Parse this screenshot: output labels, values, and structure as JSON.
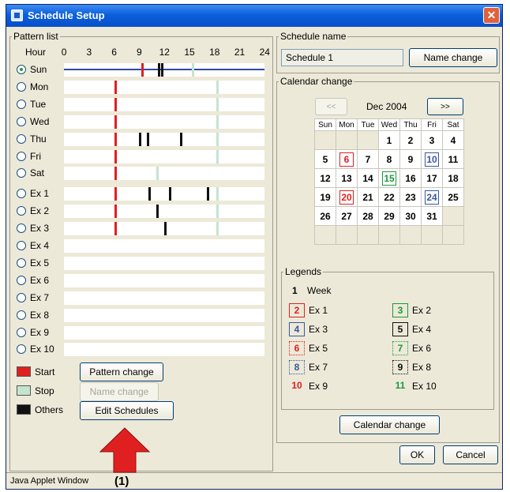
{
  "window": {
    "title": "Schedule Setup",
    "status": "Java Applet Window"
  },
  "pattern_list": {
    "legend": "Pattern list",
    "hour_label": "Hour",
    "hour_ticks": [
      "0",
      "3",
      "6",
      "9",
      "12",
      "15",
      "18",
      "21",
      "24"
    ],
    "rows": [
      {
        "label": "Sun",
        "checked": true,
        "marks": [
          {
            "h": 9.3,
            "t": "start"
          },
          {
            "h": 15.3,
            "t": "stop"
          },
          {
            "h": 11.2,
            "t": "other"
          },
          {
            "h": 11.6,
            "t": "other"
          }
        ]
      },
      {
        "label": "Mon",
        "checked": false,
        "marks": [
          {
            "h": 6,
            "t": "start"
          },
          {
            "h": 18.2,
            "t": "stop"
          }
        ]
      },
      {
        "label": "Tue",
        "checked": false,
        "marks": [
          {
            "h": 6,
            "t": "start"
          },
          {
            "h": 18.2,
            "t": "stop"
          }
        ]
      },
      {
        "label": "Wed",
        "checked": false,
        "marks": [
          {
            "h": 6,
            "t": "start"
          },
          {
            "h": 18.2,
            "t": "stop"
          }
        ]
      },
      {
        "label": "Thu",
        "checked": false,
        "marks": [
          {
            "h": 6,
            "t": "start"
          },
          {
            "h": 18.2,
            "t": "stop"
          },
          {
            "h": 9,
            "t": "other"
          },
          {
            "h": 9.9,
            "t": "other"
          },
          {
            "h": 13.9,
            "t": "other"
          }
        ]
      },
      {
        "label": "Fri",
        "checked": false,
        "marks": [
          {
            "h": 6,
            "t": "start"
          },
          {
            "h": 18.2,
            "t": "stop"
          }
        ]
      },
      {
        "label": "Sat",
        "checked": false,
        "marks": [
          {
            "h": 6,
            "t": "start"
          },
          {
            "h": 11.1,
            "t": "stop"
          }
        ]
      },
      {
        "label": "Ex 1",
        "checked": false,
        "marks": [
          {
            "h": 6,
            "t": "start"
          },
          {
            "h": 18.2,
            "t": "stop"
          },
          {
            "h": 10.1,
            "t": "other"
          },
          {
            "h": 12.6,
            "t": "other"
          },
          {
            "h": 17.1,
            "t": "other"
          }
        ]
      },
      {
        "label": "Ex 2",
        "checked": false,
        "marks": [
          {
            "h": 6,
            "t": "start"
          },
          {
            "h": 18.2,
            "t": "stop"
          },
          {
            "h": 11.1,
            "t": "other"
          }
        ]
      },
      {
        "label": "Ex 3",
        "checked": false,
        "marks": [
          {
            "h": 6,
            "t": "start"
          },
          {
            "h": 18.2,
            "t": "stop"
          },
          {
            "h": 12.0,
            "t": "other"
          }
        ]
      },
      {
        "label": "Ex 4",
        "checked": false,
        "marks": []
      },
      {
        "label": "Ex 5",
        "checked": false,
        "marks": []
      },
      {
        "label": "Ex 6",
        "checked": false,
        "marks": []
      },
      {
        "label": "Ex 7",
        "checked": false,
        "marks": []
      },
      {
        "label": "Ex 8",
        "checked": false,
        "marks": []
      },
      {
        "label": "Ex 9",
        "checked": false,
        "marks": []
      },
      {
        "label": "Ex 10",
        "checked": false,
        "marks": []
      }
    ],
    "legend_items": [
      "Start",
      "Stop",
      "Others"
    ],
    "buttons": {
      "pattern_change": "Pattern change",
      "name_change": "Name change",
      "edit_schedules": "Edit Schedules"
    }
  },
  "schedule_name": {
    "legend": "Schedule name",
    "value": "Schedule 1",
    "button": "Name change"
  },
  "calendar": {
    "legend": "Calendar change",
    "prev": "<<",
    "next": ">>",
    "month": "Dec 2004",
    "weekdays": [
      "Sun",
      "Mon",
      "Tue",
      "Wed",
      "Thu",
      "Fri",
      "Sat"
    ],
    "weeks": [
      [
        {
          "d": ""
        },
        {
          "d": ""
        },
        {
          "d": ""
        },
        {
          "d": "1",
          "c": "week"
        },
        {
          "d": "2",
          "c": "week"
        },
        {
          "d": "3",
          "c": "week"
        },
        {
          "d": "4",
          "c": "week"
        }
      ],
      [
        {
          "d": "5",
          "c": "week"
        },
        {
          "d": "6",
          "c": "ex1"
        },
        {
          "d": "7",
          "c": "week"
        },
        {
          "d": "8",
          "c": "week"
        },
        {
          "d": "9",
          "c": "week"
        },
        {
          "d": "10",
          "c": "ex3"
        },
        {
          "d": "11",
          "c": "week"
        }
      ],
      [
        {
          "d": "12",
          "c": "week"
        },
        {
          "d": "13",
          "c": "week"
        },
        {
          "d": "14",
          "c": "week"
        },
        {
          "d": "15",
          "c": "ex2"
        },
        {
          "d": "16",
          "c": "week"
        },
        {
          "d": "17",
          "c": "week"
        },
        {
          "d": "18",
          "c": "week"
        }
      ],
      [
        {
          "d": "19",
          "c": "week"
        },
        {
          "d": "20",
          "c": "ex1"
        },
        {
          "d": "21",
          "c": "week"
        },
        {
          "d": "22",
          "c": "week"
        },
        {
          "d": "23",
          "c": "week"
        },
        {
          "d": "24",
          "c": "ex3"
        },
        {
          "d": "25",
          "c": "week"
        }
      ],
      [
        {
          "d": "26",
          "c": "week"
        },
        {
          "d": "27",
          "c": "week"
        },
        {
          "d": "28",
          "c": "week"
        },
        {
          "d": "29",
          "c": "week"
        },
        {
          "d": "30",
          "c": "week"
        },
        {
          "d": "31",
          "c": "week"
        },
        {
          "d": ""
        }
      ],
      [
        {
          "d": ""
        },
        {
          "d": ""
        },
        {
          "d": ""
        },
        {
          "d": ""
        },
        {
          "d": ""
        },
        {
          "d": ""
        },
        {
          "d": ""
        }
      ]
    ],
    "change_button": "Calendar change"
  },
  "legends": {
    "legend": "Legends",
    "week": {
      "num": "1",
      "label": "Week"
    },
    "items": [
      {
        "num": "2",
        "label": "Ex 1",
        "style": "ex1"
      },
      {
        "num": "3",
        "label": "Ex 2",
        "style": "ex2"
      },
      {
        "num": "4",
        "label": "Ex 3",
        "style": "ex3"
      },
      {
        "num": "5",
        "label": "Ex 4",
        "style": "ex4"
      },
      {
        "num": "6",
        "label": "Ex 5",
        "style": "ex5"
      },
      {
        "num": "7",
        "label": "Ex 6",
        "style": "ex6"
      },
      {
        "num": "8",
        "label": "Ex 7",
        "style": "ex7"
      },
      {
        "num": "9",
        "label": "Ex 8",
        "style": "ex8"
      },
      {
        "num": "10",
        "label": "Ex 9",
        "style": "ex9"
      },
      {
        "num": "11",
        "label": "Ex 10",
        "style": "ex10"
      }
    ]
  },
  "dialog": {
    "ok": "OK",
    "cancel": "Cancel"
  },
  "annotation": "(1)",
  "colors": {
    "start": "#e02020",
    "stop": "#c4e4d0",
    "other": "#111111",
    "sun_line": "#2b4aa8",
    "ex1": "#e02020",
    "ex2": "#1a9a3a",
    "ex3": "#3a58a0",
    "ex4": "#111111",
    "ex9": "#e02020",
    "ex10": "#1a9a3a",
    "arrow": "#e02020"
  }
}
